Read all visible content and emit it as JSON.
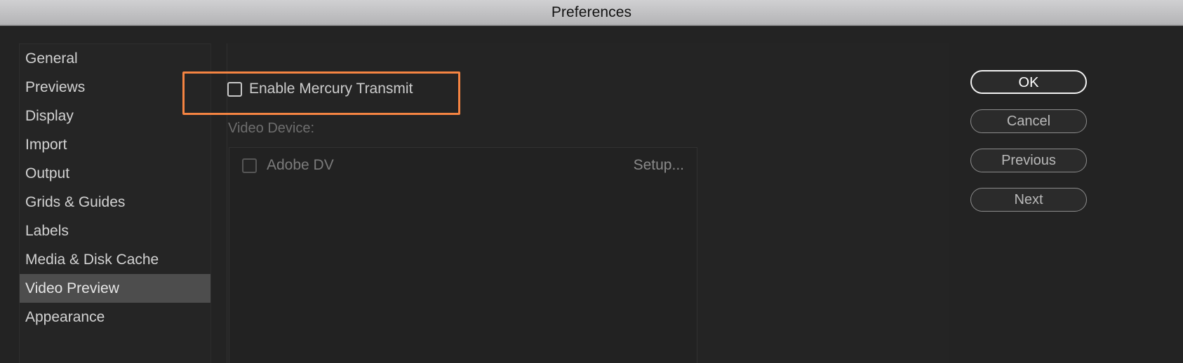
{
  "window": {
    "title": "Preferences"
  },
  "sidebar": {
    "items": [
      {
        "label": "General",
        "selected": false
      },
      {
        "label": "Previews",
        "selected": false
      },
      {
        "label": "Display",
        "selected": false
      },
      {
        "label": "Import",
        "selected": false
      },
      {
        "label": "Output",
        "selected": false
      },
      {
        "label": "Grids & Guides",
        "selected": false
      },
      {
        "label": "Labels",
        "selected": false
      },
      {
        "label": "Media & Disk Cache",
        "selected": false
      },
      {
        "label": "Video Preview",
        "selected": true
      },
      {
        "label": "Appearance",
        "selected": false
      }
    ]
  },
  "content": {
    "mercury": {
      "label": "Enable Mercury Transmit",
      "checked": false
    },
    "video_device_label": "Video Device:",
    "devices": [
      {
        "name": "Adobe DV",
        "checked": false,
        "setup_label": "Setup..."
      }
    ]
  },
  "buttons": [
    {
      "label": "OK",
      "primary": true
    },
    {
      "label": "Cancel",
      "primary": false
    },
    {
      "label": "Previous",
      "primary": false
    },
    {
      "label": "Next",
      "primary": false
    }
  ],
  "annotation": {
    "highlight_color": "#f58442",
    "target": "Enable Mercury Transmit"
  }
}
